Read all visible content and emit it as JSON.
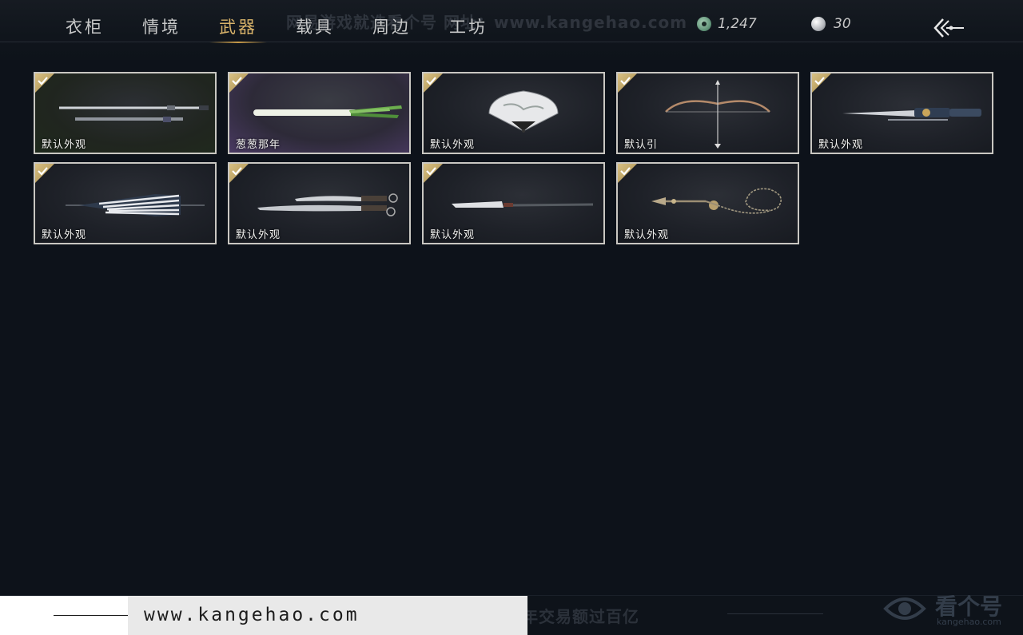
{
  "watermark_top": "网易游戏就选看个号   网址：www.kangehao.com",
  "tabs": [
    {
      "label": "衣柜",
      "active": false
    },
    {
      "label": "情境",
      "active": false
    },
    {
      "label": "武器",
      "active": true
    },
    {
      "label": "载具",
      "active": false
    },
    {
      "label": "周边",
      "active": false
    },
    {
      "label": "工坊",
      "active": false
    }
  ],
  "currency": {
    "coins": "1,247",
    "pearls": "30"
  },
  "items": [
    {
      "label": "默认外观",
      "equipped": true,
      "weapon": "sword"
    },
    {
      "label": "葱葱那年",
      "equipped": true,
      "weapon": "scallion"
    },
    {
      "label": "默认外观",
      "equipped": true,
      "weapon": "fan"
    },
    {
      "label": "默认引",
      "equipped": true,
      "weapon": "bow"
    },
    {
      "label": "默认外观",
      "equipped": true,
      "weapon": "dual-blade"
    },
    {
      "label": "默认外观",
      "equipped": true,
      "weapon": "umbrella"
    },
    {
      "label": "默认外观",
      "equipped": true,
      "weapon": "twin-sabers"
    },
    {
      "label": "默认外观",
      "equipped": true,
      "weapon": "glaive"
    },
    {
      "label": "默认外观",
      "equipped": true,
      "weapon": "rope-dart"
    }
  ],
  "bottom": {
    "slogan": "看个号专业网易游戏八年   年交易额过百亿",
    "url": "www.kangehao.com",
    "logo_text": "看个号",
    "logo_sub": "kangehao.com"
  },
  "colors": {
    "background": "#0d121a",
    "active_tab": "#d9b36a",
    "card_border": "#c9c7c2",
    "check_badge": "#c8ad6a"
  }
}
